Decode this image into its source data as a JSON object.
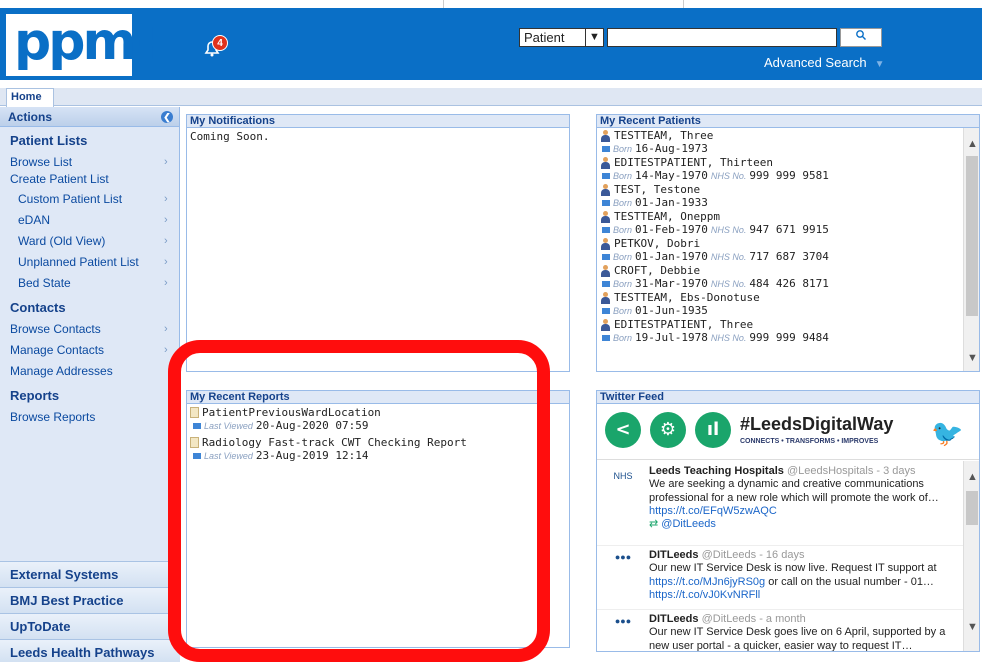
{
  "app": {
    "logo_text": "ppm+",
    "notification_count": "4"
  },
  "search": {
    "type_value": "Patient",
    "query_value": "",
    "advanced_label": "Advanced Search"
  },
  "tabs": [
    {
      "label": "Home"
    }
  ],
  "sidebar": {
    "actions_label": "Actions",
    "sections": [
      {
        "title": "Patient Lists"
      },
      {
        "title": "Contacts"
      },
      {
        "title": "Reports"
      }
    ],
    "items": [
      {
        "label": "Browse List"
      },
      {
        "label": "Create Patient List"
      },
      {
        "label": "Custom Patient List"
      },
      {
        "label": "eDAN"
      },
      {
        "label": "Ward (Old View)"
      },
      {
        "label": "Unplanned Patient List"
      },
      {
        "label": "Bed State"
      },
      {
        "label": "Browse Contacts"
      },
      {
        "label": "Manage Contacts"
      },
      {
        "label": "Manage Addresses"
      },
      {
        "label": "Browse Reports"
      }
    ],
    "bottom": [
      {
        "label": "External Systems"
      },
      {
        "label": "BMJ Best Practice"
      },
      {
        "label": "UpToDate"
      },
      {
        "label": "Leeds Health Pathways"
      }
    ]
  },
  "notifications": {
    "title": "My Notifications",
    "body": "Coming Soon."
  },
  "reports": {
    "title": "My Recent Reports",
    "last_viewed_label": "Last Viewed",
    "items": [
      {
        "name": "PatientPreviousWardLocation",
        "viewed": "20-Aug-2020 07:59"
      },
      {
        "name": "Radiology Fast-track CWT Checking Report",
        "viewed": "23-Aug-2019 12:14"
      }
    ]
  },
  "patients": {
    "title": "My Recent Patients",
    "born_label": "Born",
    "nhs_label": "NHS No.",
    "items": [
      {
        "name": "TESTTEAM, Three",
        "born": "16-Aug-1973",
        "nhs": ""
      },
      {
        "name": "EDITESTPATIENT, Thirteen",
        "born": "14-May-1970",
        "nhs": "999 999 9581"
      },
      {
        "name": "TEST, Testone",
        "born": "01-Jan-1933",
        "nhs": ""
      },
      {
        "name": "TESTTEAM, Oneppm",
        "born": "01-Feb-1970",
        "nhs": "947 671 9915"
      },
      {
        "name": "PETKOV, Dobri",
        "born": "01-Jan-1970",
        "nhs": "717 687 3704"
      },
      {
        "name": "CROFT, Debbie",
        "born": "31-Mar-1970",
        "nhs": "484 426 8171"
      },
      {
        "name": "TESTTEAM, Ebs-Donotuse",
        "born": "01-Jun-1935",
        "nhs": ""
      },
      {
        "name": "EDITESTPATIENT, Three",
        "born": "19-Jul-1978",
        "nhs": "999 999 9484"
      }
    ]
  },
  "twitter": {
    "title": "Twitter Feed",
    "banner_hashtag": "#LeedsDigitalWay",
    "banner_tagline": "CONNECTS • TRANSFORMS • IMPROVES",
    "tweets": [
      {
        "name": "Leeds Teaching Hospitals",
        "handle": "@LeedsHospitals - 3 days",
        "text": "We are seeking a dynamic and creative communications professional for a new role which will promote the work of…",
        "link": "https://t.co/EFqW5zwAQC",
        "retweet": "@DitLeeds"
      },
      {
        "name": "DITLeeds",
        "handle": "@DitLeeds - 16 days",
        "text": "Our new IT Service Desk is now live. Request IT support at",
        "link": "https://t.co/MJn6jyRS0g",
        "text2": "or call on the usual number - 01…",
        "link2": "https://t.co/vJ0KvNRFll"
      },
      {
        "name": "DITLeeds",
        "handle": "@DitLeeds - a month",
        "text": "Our new IT Service Desk goes live on 6 April, supported by a new user portal - a quicker, easier way to request IT…"
      }
    ]
  },
  "colors": {
    "header": "#0a6fc6",
    "annotation": "#ff0d0d"
  }
}
